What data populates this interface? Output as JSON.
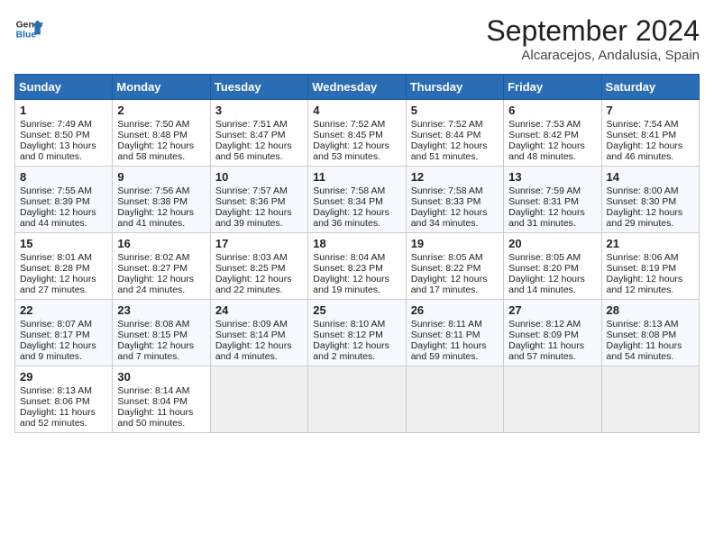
{
  "header": {
    "logo_line1": "General",
    "logo_line2": "Blue",
    "month": "September 2024",
    "location": "Alcaracejos, Andalusia, Spain"
  },
  "weekdays": [
    "Sunday",
    "Monday",
    "Tuesday",
    "Wednesday",
    "Thursday",
    "Friday",
    "Saturday"
  ],
  "weeks": [
    [
      {
        "day": "1",
        "sunrise": "Sunrise: 7:49 AM",
        "sunset": "Sunset: 8:50 PM",
        "daylight": "Daylight: 13 hours and 0 minutes."
      },
      {
        "day": "2",
        "sunrise": "Sunrise: 7:50 AM",
        "sunset": "Sunset: 8:48 PM",
        "daylight": "Daylight: 12 hours and 58 minutes."
      },
      {
        "day": "3",
        "sunrise": "Sunrise: 7:51 AM",
        "sunset": "Sunset: 8:47 PM",
        "daylight": "Daylight: 12 hours and 56 minutes."
      },
      {
        "day": "4",
        "sunrise": "Sunrise: 7:52 AM",
        "sunset": "Sunset: 8:45 PM",
        "daylight": "Daylight: 12 hours and 53 minutes."
      },
      {
        "day": "5",
        "sunrise": "Sunrise: 7:52 AM",
        "sunset": "Sunset: 8:44 PM",
        "daylight": "Daylight: 12 hours and 51 minutes."
      },
      {
        "day": "6",
        "sunrise": "Sunrise: 7:53 AM",
        "sunset": "Sunset: 8:42 PM",
        "daylight": "Daylight: 12 hours and 48 minutes."
      },
      {
        "day": "7",
        "sunrise": "Sunrise: 7:54 AM",
        "sunset": "Sunset: 8:41 PM",
        "daylight": "Daylight: 12 hours and 46 minutes."
      }
    ],
    [
      {
        "day": "8",
        "sunrise": "Sunrise: 7:55 AM",
        "sunset": "Sunset: 8:39 PM",
        "daylight": "Daylight: 12 hours and 44 minutes."
      },
      {
        "day": "9",
        "sunrise": "Sunrise: 7:56 AM",
        "sunset": "Sunset: 8:38 PM",
        "daylight": "Daylight: 12 hours and 41 minutes."
      },
      {
        "day": "10",
        "sunrise": "Sunrise: 7:57 AM",
        "sunset": "Sunset: 8:36 PM",
        "daylight": "Daylight: 12 hours and 39 minutes."
      },
      {
        "day": "11",
        "sunrise": "Sunrise: 7:58 AM",
        "sunset": "Sunset: 8:34 PM",
        "daylight": "Daylight: 12 hours and 36 minutes."
      },
      {
        "day": "12",
        "sunrise": "Sunrise: 7:58 AM",
        "sunset": "Sunset: 8:33 PM",
        "daylight": "Daylight: 12 hours and 34 minutes."
      },
      {
        "day": "13",
        "sunrise": "Sunrise: 7:59 AM",
        "sunset": "Sunset: 8:31 PM",
        "daylight": "Daylight: 12 hours and 31 minutes."
      },
      {
        "day": "14",
        "sunrise": "Sunrise: 8:00 AM",
        "sunset": "Sunset: 8:30 PM",
        "daylight": "Daylight: 12 hours and 29 minutes."
      }
    ],
    [
      {
        "day": "15",
        "sunrise": "Sunrise: 8:01 AM",
        "sunset": "Sunset: 8:28 PM",
        "daylight": "Daylight: 12 hours and 27 minutes."
      },
      {
        "day": "16",
        "sunrise": "Sunrise: 8:02 AM",
        "sunset": "Sunset: 8:27 PM",
        "daylight": "Daylight: 12 hours and 24 minutes."
      },
      {
        "day": "17",
        "sunrise": "Sunrise: 8:03 AM",
        "sunset": "Sunset: 8:25 PM",
        "daylight": "Daylight: 12 hours and 22 minutes."
      },
      {
        "day": "18",
        "sunrise": "Sunrise: 8:04 AM",
        "sunset": "Sunset: 8:23 PM",
        "daylight": "Daylight: 12 hours and 19 minutes."
      },
      {
        "day": "19",
        "sunrise": "Sunrise: 8:05 AM",
        "sunset": "Sunset: 8:22 PM",
        "daylight": "Daylight: 12 hours and 17 minutes."
      },
      {
        "day": "20",
        "sunrise": "Sunrise: 8:05 AM",
        "sunset": "Sunset: 8:20 PM",
        "daylight": "Daylight: 12 hours and 14 minutes."
      },
      {
        "day": "21",
        "sunrise": "Sunrise: 8:06 AM",
        "sunset": "Sunset: 8:19 PM",
        "daylight": "Daylight: 12 hours and 12 minutes."
      }
    ],
    [
      {
        "day": "22",
        "sunrise": "Sunrise: 8:07 AM",
        "sunset": "Sunset: 8:17 PM",
        "daylight": "Daylight: 12 hours and 9 minutes."
      },
      {
        "day": "23",
        "sunrise": "Sunrise: 8:08 AM",
        "sunset": "Sunset: 8:15 PM",
        "daylight": "Daylight: 12 hours and 7 minutes."
      },
      {
        "day": "24",
        "sunrise": "Sunrise: 8:09 AM",
        "sunset": "Sunset: 8:14 PM",
        "daylight": "Daylight: 12 hours and 4 minutes."
      },
      {
        "day": "25",
        "sunrise": "Sunrise: 8:10 AM",
        "sunset": "Sunset: 8:12 PM",
        "daylight": "Daylight: 12 hours and 2 minutes."
      },
      {
        "day": "26",
        "sunrise": "Sunrise: 8:11 AM",
        "sunset": "Sunset: 8:11 PM",
        "daylight": "Daylight: 11 hours and 59 minutes."
      },
      {
        "day": "27",
        "sunrise": "Sunrise: 8:12 AM",
        "sunset": "Sunset: 8:09 PM",
        "daylight": "Daylight: 11 hours and 57 minutes."
      },
      {
        "day": "28",
        "sunrise": "Sunrise: 8:13 AM",
        "sunset": "Sunset: 8:08 PM",
        "daylight": "Daylight: 11 hours and 54 minutes."
      }
    ],
    [
      {
        "day": "29",
        "sunrise": "Sunrise: 8:13 AM",
        "sunset": "Sunset: 8:06 PM",
        "daylight": "Daylight: 11 hours and 52 minutes."
      },
      {
        "day": "30",
        "sunrise": "Sunrise: 8:14 AM",
        "sunset": "Sunset: 8:04 PM",
        "daylight": "Daylight: 11 hours and 50 minutes."
      },
      null,
      null,
      null,
      null,
      null
    ]
  ]
}
